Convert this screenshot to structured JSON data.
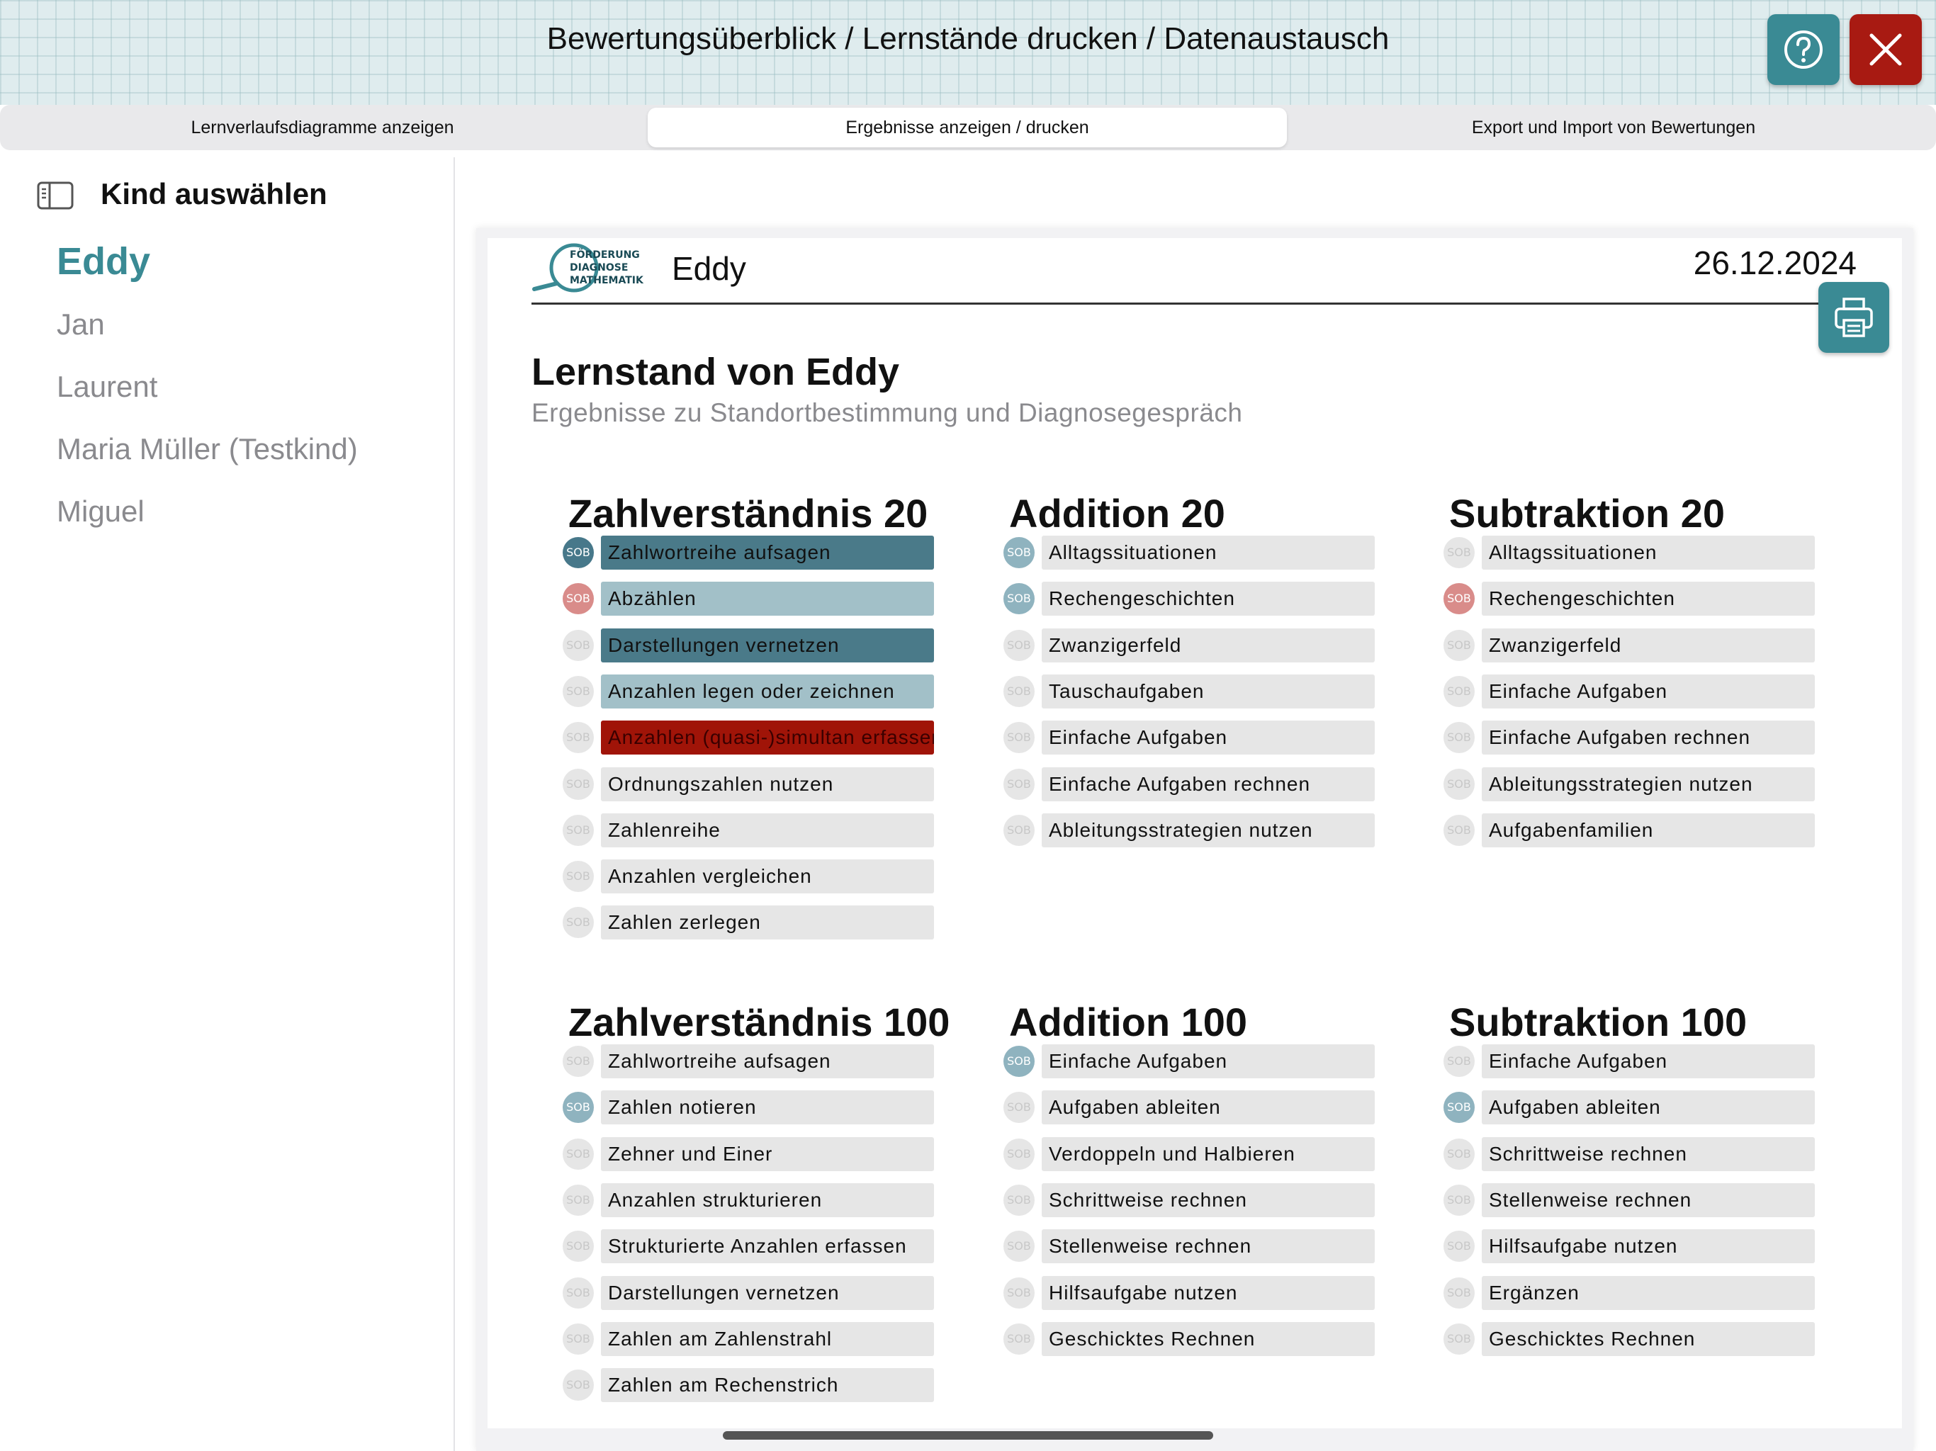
{
  "header": {
    "title": "Bewertungsüberblick / Lernstände drucken / Datenaustausch"
  },
  "tabs": [
    {
      "label": "Lernverlaufsdiagramme anzeigen"
    },
    {
      "label": "Ergebnisse anzeigen / drucken"
    },
    {
      "label": "Export und Import von Bewertungen"
    }
  ],
  "sidebar": {
    "title": "Kind auswählen",
    "children": [
      {
        "name": "Eddy"
      },
      {
        "name": "Jan"
      },
      {
        "name": "Laurent"
      },
      {
        "name": "Maria Müller (Testkind)"
      },
      {
        "name": "Miguel"
      }
    ]
  },
  "colors": {
    "accent": "#3a8a94",
    "close": "#a81a12",
    "badge_dark": "#47788a",
    "badge_light": "#8fb3bf",
    "badge_red": "#d98c8a",
    "badge_empty": "#e6e6e6",
    "bar_dark": "#4a7a89",
    "bar_light": "#a2c0c8",
    "bar_red": "#a01408",
    "bar_empty": "#e6e6e6"
  },
  "report": {
    "logo_lines": [
      "FÖRDERUNG",
      "DIAGNOSE",
      "MATHEMATIK"
    ],
    "child_name": "Eddy",
    "date": "26.12.2024",
    "heading": "Lernstand von Eddy",
    "subheading": "Ergebnisse zu Standortbestimmung und Diagnosegespräch",
    "badge_label": "SOB",
    "categories": [
      {
        "title": "Zahlverständnis 20",
        "items": [
          {
            "label": "Zahlwortreihe aufsagen",
            "badge": "dark",
            "bar": "dark"
          },
          {
            "label": "Abzählen",
            "badge": "red",
            "bar": "light"
          },
          {
            "label": "Darstellungen vernetzen",
            "badge": "none",
            "bar": "dark"
          },
          {
            "label": "Anzahlen legen oder zeichnen",
            "badge": "none",
            "bar": "light"
          },
          {
            "label": "Anzahlen (quasi-)simultan erfassen",
            "badge": "none",
            "bar": "red"
          },
          {
            "label": "Ordnungszahlen nutzen",
            "badge": "none",
            "bar": "none"
          },
          {
            "label": "Zahlenreihe",
            "badge": "none",
            "bar": "none"
          },
          {
            "label": "Anzahlen vergleichen",
            "badge": "none",
            "bar": "none"
          },
          {
            "label": "Zahlen zerlegen",
            "badge": "none",
            "bar": "none"
          }
        ]
      },
      {
        "title": "Addition 20",
        "items": [
          {
            "label": "Alltagssituationen",
            "badge": "light",
            "bar": "none"
          },
          {
            "label": "Rechengeschichten",
            "badge": "light",
            "bar": "none"
          },
          {
            "label": "Zwanzigerfeld",
            "badge": "none",
            "bar": "none"
          },
          {
            "label": "Tauschaufgaben",
            "badge": "none",
            "bar": "none"
          },
          {
            "label": "Einfache Aufgaben",
            "badge": "none",
            "bar": "none"
          },
          {
            "label": "Einfache Aufgaben rechnen",
            "badge": "none",
            "bar": "none"
          },
          {
            "label": "Ableitungsstrategien nutzen",
            "badge": "none",
            "bar": "none"
          }
        ]
      },
      {
        "title": "Subtraktion 20",
        "items": [
          {
            "label": "Alltagssituationen",
            "badge": "none",
            "bar": "none"
          },
          {
            "label": "Rechengeschichten",
            "badge": "red",
            "bar": "none"
          },
          {
            "label": "Zwanzigerfeld",
            "badge": "none",
            "bar": "none"
          },
          {
            "label": "Einfache Aufgaben",
            "badge": "none",
            "bar": "none"
          },
          {
            "label": "Einfache Aufgaben rechnen",
            "badge": "none",
            "bar": "none"
          },
          {
            "label": "Ableitungsstrategien nutzen",
            "badge": "none",
            "bar": "none"
          },
          {
            "label": "Aufgabenfamilien",
            "badge": "none",
            "bar": "none"
          }
        ]
      },
      {
        "title": "Zahlverständnis 100",
        "items": [
          {
            "label": "Zahlwortreihe aufsagen",
            "badge": "none",
            "bar": "none"
          },
          {
            "label": "Zahlen notieren",
            "badge": "light",
            "bar": "none"
          },
          {
            "label": "Zehner und Einer",
            "badge": "none",
            "bar": "none"
          },
          {
            "label": "Anzahlen strukturieren",
            "badge": "none",
            "bar": "none"
          },
          {
            "label": "Strukturierte Anzahlen erfassen",
            "badge": "none",
            "bar": "none"
          },
          {
            "label": "Darstellungen vernetzen",
            "badge": "none",
            "bar": "none"
          },
          {
            "label": "Zahlen am Zahlenstrahl",
            "badge": "none",
            "bar": "none"
          },
          {
            "label": "Zahlen am Rechenstrich",
            "badge": "none",
            "bar": "none"
          }
        ]
      },
      {
        "title": "Addition 100",
        "items": [
          {
            "label": "Einfache Aufgaben",
            "badge": "light",
            "bar": "none"
          },
          {
            "label": "Aufgaben ableiten",
            "badge": "none",
            "bar": "none"
          },
          {
            "label": "Verdoppeln und Halbieren",
            "badge": "none",
            "bar": "none"
          },
          {
            "label": "Schrittweise rechnen",
            "badge": "none",
            "bar": "none"
          },
          {
            "label": "Stellenweise rechnen",
            "badge": "none",
            "bar": "none"
          },
          {
            "label": "Hilfsaufgabe nutzen",
            "badge": "none",
            "bar": "none"
          },
          {
            "label": "Geschicktes Rechnen",
            "badge": "none",
            "bar": "none"
          }
        ]
      },
      {
        "title": "Subtraktion 100",
        "items": [
          {
            "label": "Einfache Aufgaben",
            "badge": "none",
            "bar": "none"
          },
          {
            "label": "Aufgaben ableiten",
            "badge": "light",
            "bar": "none"
          },
          {
            "label": "Schrittweise rechnen",
            "badge": "none",
            "bar": "none"
          },
          {
            "label": "Stellenweise rechnen",
            "badge": "none",
            "bar": "none"
          },
          {
            "label": "Hilfsaufgabe nutzen",
            "badge": "none",
            "bar": "none"
          },
          {
            "label": "Ergänzen",
            "badge": "none",
            "bar": "none"
          },
          {
            "label": "Geschicktes Rechnen",
            "badge": "none",
            "bar": "none"
          }
        ]
      }
    ]
  }
}
